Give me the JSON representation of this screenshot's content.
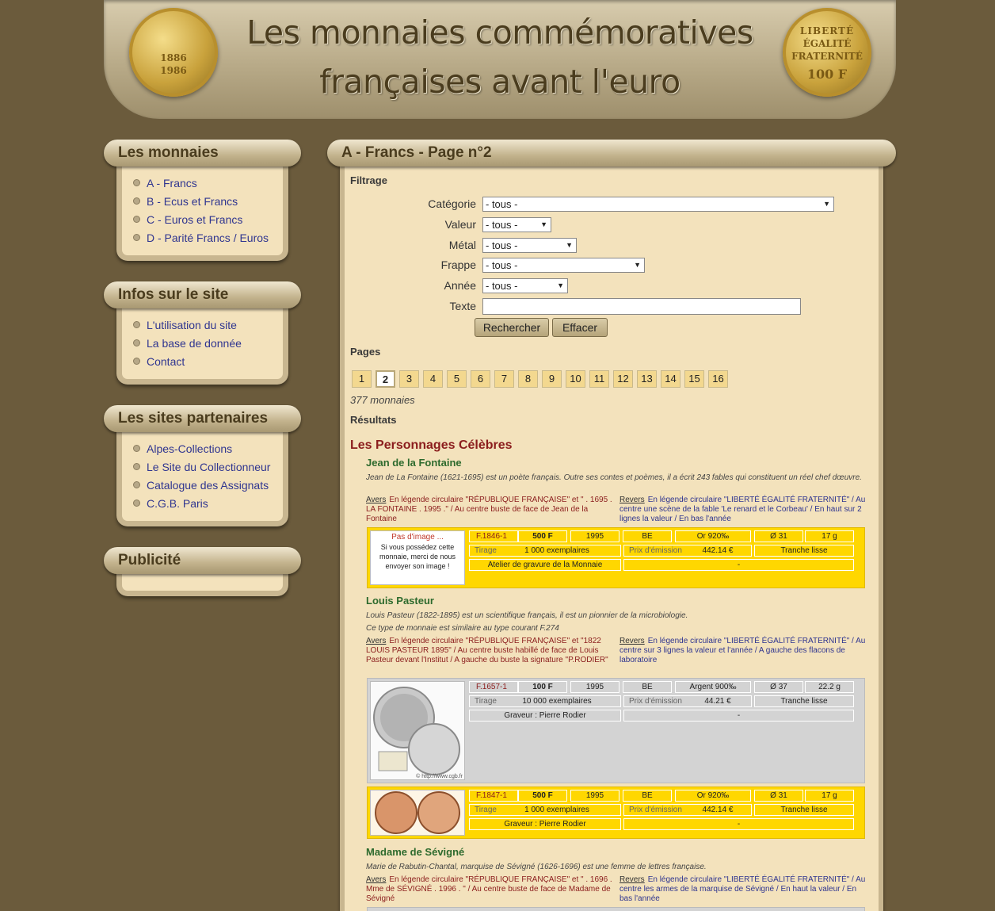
{
  "header": {
    "title_line1": "Les monnaies commémoratives",
    "title_line2": "françaises avant l'euro",
    "coin_left": {
      "a": "1886",
      "b": "1986"
    },
    "coin_right": {
      "a": "LIBERTÉ",
      "b": "ÉGALITÉ",
      "c": "FRATERNITÉ",
      "d": "100 F"
    }
  },
  "sidebar": {
    "monnaies": {
      "title": "Les monnaies",
      "items": [
        "A - Francs",
        "B - Ecus et Francs",
        "C - Euros et Francs",
        "D - Parité Francs / Euros"
      ]
    },
    "infos": {
      "title": "Infos sur le site",
      "items": [
        "L'utilisation du site",
        "La base de donnée",
        "Contact"
      ]
    },
    "partenaires": {
      "title": "Les sites partenaires",
      "items": [
        "Alpes-Collections",
        "Le Site du Collectionneur",
        "Catalogue des Assignats",
        "C.G.B. Paris"
      ]
    },
    "publicite": {
      "title": "Publicité"
    }
  },
  "main": {
    "title": "A - Francs - Page n°2",
    "filtrage": {
      "heading": "Filtrage",
      "categorie": {
        "label": "Catégorie",
        "value": "- tous -"
      },
      "valeur": {
        "label": "Valeur",
        "value": "- tous -"
      },
      "metal": {
        "label": "Métal",
        "value": "- tous -"
      },
      "frappe": {
        "label": "Frappe",
        "value": "- tous -"
      },
      "annee": {
        "label": "Année",
        "value": "- tous -"
      },
      "texte": {
        "label": "Texte",
        "value": ""
      },
      "search_button": "Rechercher",
      "clear_button": "Effacer"
    },
    "pages_heading": "Pages",
    "pages": [
      "1",
      "2",
      "3",
      "4",
      "5",
      "6",
      "7",
      "8",
      "9",
      "10",
      "11",
      "12",
      "13",
      "14",
      "15",
      "16"
    ],
    "current_page": "2",
    "count": "377 monnaies",
    "results_heading": "Résultats",
    "category": "Les Personnages Célèbres",
    "coins": [
      {
        "name": "Jean de la Fontaine",
        "desc": "Jean de La Fontaine (1621-1695) est un poète français. Outre ses contes et poèmes, il a écrit 243 fables qui constituent un réel chef dœuvre.",
        "avers_label": "Avers",
        "avers": "En légende circulaire \"RÉPUBLIQUE FRANÇAISE\" et \" . 1695 . LA FONTAINE . 1995 .\" / Au centre buste de face de Jean de la Fontaine",
        "revers_label": "Revers",
        "revers": "En légende circulaire \"LIBERTÉ ÉGALITÉ FRATERNITÉ\" / Au centre une scène de la fable 'Le renard et le Corbeau' / En haut sur 2 lignes la valeur / En bas l'année",
        "variants": [
          {
            "style": "gold",
            "no_image_title": "Pas d'image ...",
            "no_image_text": "Si vous possédez cette monnaie, merci de nous envoyer son image !",
            "ref": "F.1846-1",
            "value": "500 F",
            "year": "1995",
            "strike": "BE",
            "metal": "Or 920‰",
            "diameter": "Ø 31",
            "weight": "17 g",
            "tirage_label": "Tirage",
            "tirage": "1 000 exemplaires",
            "prix_label": "Prix d'émission",
            "prix": "442.14 €",
            "tranche": "Tranche lisse",
            "graveur": "Atelier de gravure de la Monnaie",
            "other": "-"
          }
        ]
      },
      {
        "name": "Louis Pasteur",
        "desc": "Louis Pasteur (1822-1895) est un scientifique français, il est un pionnier de la microbiologie.",
        "desc2": "Ce type de monnaie est similaire au type courant F.274",
        "avers_label": "Avers",
        "avers": "En légende circulaire \"RÉPUBLIQUE FRANÇAISE\" et \"1822 LOUIS PASTEUR 1895\" / Au centre buste habillé de face de Louis Pasteur devant l'Institut / A gauche du buste la signature \"P.RODIER\"",
        "revers_label": "Revers",
        "revers": "En légende circulaire \"LIBERTÉ ÉGALITÉ FRATERNITÉ\" / Au centre sur 3 lignes la valeur et l'année / A gauche des flacons de laboratoire",
        "variants": [
          {
            "style": "silver",
            "ref": "F.1657-1",
            "value": "100 F",
            "year": "1995",
            "strike": "BE",
            "metal": "Argent 900‰",
            "diameter": "Ø 37",
            "weight": "22.2 g",
            "tirage_label": "Tirage",
            "tirage": "10 000 exemplaires",
            "prix_label": "Prix d'émission",
            "prix": "44.21 €",
            "tranche": "Tranche lisse",
            "graveur": "Graveur : Pierre Rodier",
            "other": "-",
            "image_caption": "© http://www.cgb.fr"
          },
          {
            "style": "gold",
            "ref": "F.1847-1",
            "value": "500 F",
            "year": "1995",
            "strike": "BE",
            "metal": "Or 920‰",
            "diameter": "Ø 31",
            "weight": "17 g",
            "tirage_label": "Tirage",
            "tirage": "1 000 exemplaires",
            "prix_label": "Prix d'émission",
            "prix": "442.14 €",
            "tranche": "Tranche lisse",
            "graveur": "Graveur : Pierre Rodier",
            "other": "-"
          }
        ]
      },
      {
        "name": "Madame de Sévigné",
        "desc": "Marie de Rabutin-Chantal, marquise de Sévigné (1626-1696) est une femme de lettres française.",
        "avers_label": "Avers",
        "avers": "En légende circulaire \"RÉPUBLIQUE FRANÇAISE\" et \" . 1696 . Mme de SÉVIGNÉ . 1996 . \" / Au centre buste de face de Madame de Sévigné",
        "revers_label": "Revers",
        "revers": "En légende circulaire \"LIBERTÉ ÉGALITÉ FRATERNITÉ\" / Au centre les armes de la marquise de Sévigné / En haut la valeur / En bas l'année"
      }
    ]
  }
}
